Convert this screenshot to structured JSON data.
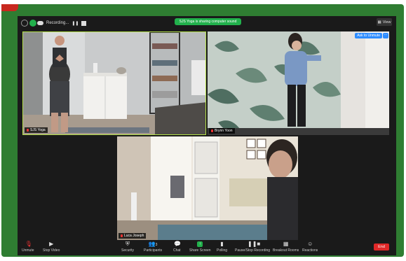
{
  "top_bar": {
    "recording_label": "Recording...",
    "share_banner": "SJS Yoga is sharing computer sound",
    "view_label": "View"
  },
  "tiles": [
    {
      "name": "SJS Yoga"
    },
    {
      "name": "Brynn Yoon",
      "ask_unmute": "Ask to Unmute",
      "more": "···"
    },
    {
      "name": "Luca Joseph"
    }
  ],
  "toolbar": {
    "unmute": "Unmute",
    "stop_video": "Stop Video",
    "security": "Security",
    "participants": "Participants",
    "participants_count": "3",
    "chat": "Chat",
    "share_screen": "Share Screen",
    "polling": "Polling",
    "pause_stop_recording": "Pause/Stop Recording",
    "breakout_rooms": "Breakout Rooms",
    "reactions": "Reactions",
    "end": "End"
  }
}
